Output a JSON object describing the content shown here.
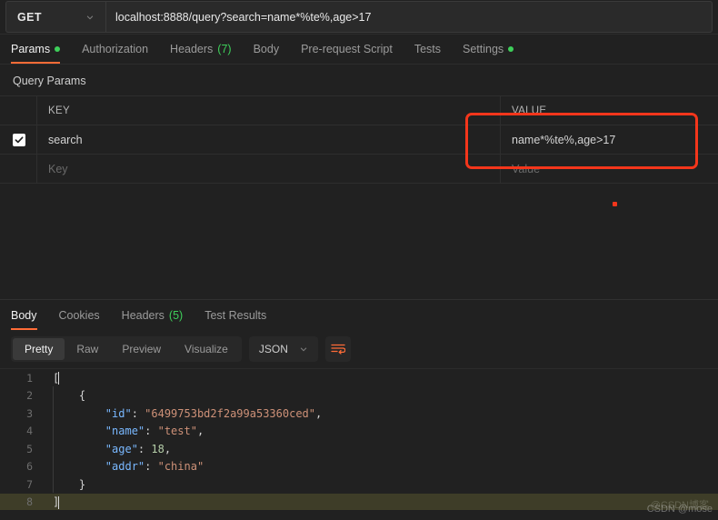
{
  "request": {
    "method": "GET",
    "url": "localhost:8888/query?search=name*%te%,age>17",
    "tabs": [
      {
        "label": "Params",
        "badge": "",
        "dot": true,
        "active": true
      },
      {
        "label": "Authorization",
        "badge": "",
        "dot": false,
        "active": false
      },
      {
        "label": "Headers",
        "badge": "(7)",
        "dot": false,
        "active": false
      },
      {
        "label": "Body",
        "badge": "",
        "dot": false,
        "active": false
      },
      {
        "label": "Pre-request Script",
        "badge": "",
        "dot": false,
        "active": false
      },
      {
        "label": "Tests",
        "badge": "",
        "dot": false,
        "active": false
      },
      {
        "label": "Settings",
        "badge": "",
        "dot": true,
        "active": false
      }
    ]
  },
  "query_params": {
    "section_title": "Query Params",
    "headers": {
      "key": "KEY",
      "value": "VALUE"
    },
    "rows": [
      {
        "checked": true,
        "key": "search",
        "value": "name*%te%,age>17"
      }
    ],
    "placeholder_row": {
      "key": "Key",
      "value": "Value"
    }
  },
  "response": {
    "tabs": [
      {
        "label": "Body",
        "badge": "",
        "active": true
      },
      {
        "label": "Cookies",
        "badge": "",
        "active": false
      },
      {
        "label": "Headers",
        "badge": "(5)",
        "active": false
      },
      {
        "label": "Test Results",
        "badge": "",
        "active": false
      }
    ],
    "format_modes": [
      {
        "label": "Pretty",
        "active": true
      },
      {
        "label": "Raw",
        "active": false
      },
      {
        "label": "Preview",
        "active": false
      },
      {
        "label": "Visualize",
        "active": false
      }
    ],
    "language": "JSON",
    "body_lines": [
      {
        "n": "1",
        "segments": [
          {
            "t": "[",
            "c": "pun"
          }
        ],
        "highlight": false,
        "caret": true
      },
      {
        "n": "2",
        "segments": [
          {
            "t": "    {",
            "c": "pun"
          }
        ],
        "highlight": false,
        "caret": false
      },
      {
        "n": "3",
        "segments": [
          {
            "t": "        ",
            "c": "pun"
          },
          {
            "t": "\"id\"",
            "c": "key"
          },
          {
            "t": ": ",
            "c": "pun"
          },
          {
            "t": "\"6499753bd2f2a99a53360ced\"",
            "c": "str"
          },
          {
            "t": ",",
            "c": "pun"
          }
        ],
        "highlight": false,
        "caret": false
      },
      {
        "n": "4",
        "segments": [
          {
            "t": "        ",
            "c": "pun"
          },
          {
            "t": "\"name\"",
            "c": "key"
          },
          {
            "t": ": ",
            "c": "pun"
          },
          {
            "t": "\"test\"",
            "c": "str"
          },
          {
            "t": ",",
            "c": "pun"
          }
        ],
        "highlight": false,
        "caret": false
      },
      {
        "n": "5",
        "segments": [
          {
            "t": "        ",
            "c": "pun"
          },
          {
            "t": "\"age\"",
            "c": "key"
          },
          {
            "t": ": ",
            "c": "pun"
          },
          {
            "t": "18",
            "c": "num"
          },
          {
            "t": ",",
            "c": "pun"
          }
        ],
        "highlight": false,
        "caret": false
      },
      {
        "n": "6",
        "segments": [
          {
            "t": "        ",
            "c": "pun"
          },
          {
            "t": "\"addr\"",
            "c": "key"
          },
          {
            "t": ": ",
            "c": "pun"
          },
          {
            "t": "\"china\"",
            "c": "str"
          }
        ],
        "highlight": false,
        "caret": false
      },
      {
        "n": "7",
        "segments": [
          {
            "t": "    }",
            "c": "pun"
          }
        ],
        "highlight": false,
        "caret": false
      },
      {
        "n": "8",
        "segments": [
          {
            "t": "]",
            "c": "pun"
          }
        ],
        "highlight": true,
        "caret": true
      }
    ]
  },
  "annotations": {
    "watermark": "CSDN @mose",
    "watermark_secondary": "@CSDN博客"
  },
  "colors": {
    "accent": "#ff6c37",
    "status_dot": "#3ecf5a",
    "annotation": "#f4361b"
  }
}
